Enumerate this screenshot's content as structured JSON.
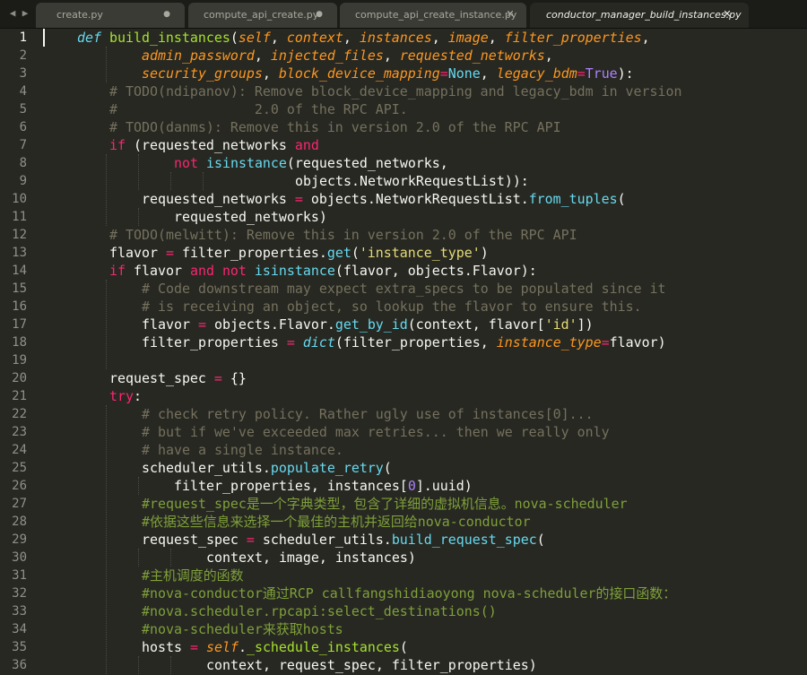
{
  "tabs": [
    {
      "label": "create.py",
      "marker": "●",
      "active": false
    },
    {
      "label": "compute_api_create.py",
      "marker": "●",
      "active": false
    },
    {
      "label": "compute_api_create_instance.py",
      "marker": "✕",
      "active": false
    },
    {
      "label": "conductor_manager_build_instances.py",
      "marker": "✕",
      "active": true
    }
  ],
  "nav": {
    "back": "◀",
    "forward": "▶"
  },
  "editor": {
    "current_line": 1,
    "line_numbers": [
      "1",
      "2",
      "3",
      "4",
      "5",
      "6",
      "7",
      "8",
      "9",
      "10",
      "11",
      "12",
      "13",
      "14",
      "15",
      "16",
      "17",
      "18",
      "19",
      "20",
      "21",
      "22",
      "23",
      "24",
      "25",
      "26",
      "27",
      "28",
      "29",
      "30",
      "31",
      "32",
      "33",
      "34",
      "35",
      "36"
    ],
    "lines": [
      {
        "indent": 4,
        "tokens": [
          [
            "d",
            "def"
          ],
          [
            "t",
            " "
          ],
          [
            "f",
            "build_instances"
          ],
          [
            "t",
            "("
          ],
          [
            "p",
            "self"
          ],
          [
            "t",
            ", "
          ],
          [
            "p",
            "context"
          ],
          [
            "t",
            ", "
          ],
          [
            "p",
            "instances"
          ],
          [
            "t",
            ", "
          ],
          [
            "p",
            "image"
          ],
          [
            "t",
            ", "
          ],
          [
            "p",
            "filter_properties"
          ],
          [
            "t",
            ","
          ]
        ]
      },
      {
        "indent": 12,
        "tokens": [
          [
            "p",
            "admin_password"
          ],
          [
            "t",
            ", "
          ],
          [
            "p",
            "injected_files"
          ],
          [
            "t",
            ", "
          ],
          [
            "p",
            "requested_networks"
          ],
          [
            "t",
            ","
          ]
        ]
      },
      {
        "indent": 12,
        "tokens": [
          [
            "p",
            "security_groups"
          ],
          [
            "t",
            ", "
          ],
          [
            "p",
            "block_device_mapping"
          ],
          [
            "k",
            "="
          ],
          [
            "b",
            "None"
          ],
          [
            "t",
            ", "
          ],
          [
            "p",
            "legacy_bdm"
          ],
          [
            "k",
            "="
          ],
          [
            "n",
            "True"
          ],
          [
            "t",
            "):"
          ]
        ]
      },
      {
        "indent": 8,
        "tokens": [
          [
            "c",
            "# TODO(ndipanov): Remove block_device_mapping and legacy_bdm in version"
          ]
        ]
      },
      {
        "indent": 8,
        "tokens": [
          [
            "c",
            "#                 2.0 of the RPC API."
          ]
        ]
      },
      {
        "indent": 8,
        "tokens": [
          [
            "c",
            "# TODO(danms): Remove this in version 2.0 of the RPC API"
          ]
        ]
      },
      {
        "indent": 8,
        "tokens": [
          [
            "k",
            "if"
          ],
          [
            "t",
            " (requested_networks "
          ],
          [
            "k",
            "and"
          ]
        ]
      },
      {
        "indent": 16,
        "tokens": [
          [
            "k",
            "not"
          ],
          [
            "t",
            " "
          ],
          [
            "b",
            "isinstance"
          ],
          [
            "t",
            "(requested_networks,"
          ]
        ]
      },
      {
        "indent": 31,
        "tokens": [
          [
            "t",
            "objects.NetworkRequestList)):"
          ]
        ]
      },
      {
        "indent": 12,
        "tokens": [
          [
            "t",
            "requested_networks "
          ],
          [
            "k",
            "="
          ],
          [
            "t",
            " objects.NetworkRequestList."
          ],
          [
            "b",
            "from_tuples"
          ],
          [
            "t",
            "("
          ]
        ]
      },
      {
        "indent": 16,
        "tokens": [
          [
            "t",
            "requested_networks)"
          ]
        ]
      },
      {
        "indent": 8,
        "tokens": [
          [
            "c",
            "# TODO(melwitt): Remove this in version 2.0 of the RPC API"
          ]
        ]
      },
      {
        "indent": 8,
        "tokens": [
          [
            "t",
            "flavor "
          ],
          [
            "k",
            "="
          ],
          [
            "t",
            " filter_properties."
          ],
          [
            "b",
            "get"
          ],
          [
            "t",
            "("
          ],
          [
            "s",
            "'instance_type'"
          ],
          [
            "t",
            ")"
          ]
        ]
      },
      {
        "indent": 8,
        "tokens": [
          [
            "k",
            "if"
          ],
          [
            "t",
            " flavor "
          ],
          [
            "k",
            "and"
          ],
          [
            "t",
            " "
          ],
          [
            "k",
            "not"
          ],
          [
            "t",
            " "
          ],
          [
            "b",
            "isinstance"
          ],
          [
            "t",
            "(flavor, objects.Flavor):"
          ]
        ]
      },
      {
        "indent": 12,
        "tokens": [
          [
            "c",
            "# Code downstream may expect extra_specs to be populated since it"
          ]
        ]
      },
      {
        "indent": 12,
        "tokens": [
          [
            "c",
            "# is receiving an object, so lookup the flavor to ensure this."
          ]
        ]
      },
      {
        "indent": 12,
        "tokens": [
          [
            "t",
            "flavor "
          ],
          [
            "k",
            "="
          ],
          [
            "t",
            " objects.Flavor."
          ],
          [
            "b",
            "get_by_id"
          ],
          [
            "t",
            "(context, flavor["
          ],
          [
            "s",
            "'id'"
          ],
          [
            "t",
            "])"
          ]
        ]
      },
      {
        "indent": 12,
        "tokens": [
          [
            "t",
            "filter_properties "
          ],
          [
            "k",
            "="
          ],
          [
            "t",
            " "
          ],
          [
            "d",
            "dict"
          ],
          [
            "t",
            "(filter_properties, "
          ],
          [
            "p",
            "instance_type"
          ],
          [
            "k",
            "="
          ],
          [
            "t",
            "flavor)"
          ]
        ]
      },
      {
        "indent": 0,
        "tokens": []
      },
      {
        "indent": 8,
        "tokens": [
          [
            "t",
            "request_spec "
          ],
          [
            "k",
            "="
          ],
          [
            "t",
            " {}"
          ]
        ]
      },
      {
        "indent": 8,
        "tokens": [
          [
            "k",
            "try"
          ],
          [
            "t",
            ":"
          ]
        ]
      },
      {
        "indent": 12,
        "tokens": [
          [
            "c",
            "# check retry policy. Rather ugly use of instances[0]..."
          ]
        ]
      },
      {
        "indent": 12,
        "tokens": [
          [
            "c",
            "# but if we've exceeded max retries... then we really only"
          ]
        ]
      },
      {
        "indent": 12,
        "tokens": [
          [
            "c",
            "# have a single instance."
          ]
        ]
      },
      {
        "indent": 12,
        "tokens": [
          [
            "t",
            "scheduler_utils."
          ],
          [
            "b",
            "populate_retry"
          ],
          [
            "t",
            "("
          ]
        ]
      },
      {
        "indent": 16,
        "tokens": [
          [
            "t",
            "filter_properties, instances["
          ],
          [
            "n",
            "0"
          ],
          [
            "t",
            "].uuid)"
          ]
        ]
      },
      {
        "indent": 12,
        "tokens": [
          [
            "ch",
            "#request_spec是一个字典类型，包含了详细的虚拟机信息。nova-scheduler"
          ]
        ]
      },
      {
        "indent": 12,
        "tokens": [
          [
            "ch",
            "#依据这些信息来选择一个最佳的主机并返回给nova-conductor"
          ]
        ]
      },
      {
        "indent": 12,
        "tokens": [
          [
            "t",
            "request_spec "
          ],
          [
            "k",
            "="
          ],
          [
            "t",
            " scheduler_utils."
          ],
          [
            "b",
            "build_request_spec"
          ],
          [
            "t",
            "("
          ]
        ]
      },
      {
        "indent": 20,
        "tokens": [
          [
            "t",
            "context, image, instances)"
          ]
        ]
      },
      {
        "indent": 12,
        "tokens": [
          [
            "ch",
            "#主机调度的函数"
          ]
        ]
      },
      {
        "indent": 12,
        "tokens": [
          [
            "ch",
            "#nova-conductor通过RCP callfangshidiaoyong nova-scheduler的接口函数："
          ]
        ]
      },
      {
        "indent": 12,
        "tokens": [
          [
            "ch",
            "#nova.scheduler.rpcapi:select_destinations()"
          ]
        ]
      },
      {
        "indent": 12,
        "tokens": [
          [
            "ch",
            "#nova-scheduler来获取hosts"
          ]
        ]
      },
      {
        "indent": 12,
        "tokens": [
          [
            "t",
            "hosts "
          ],
          [
            "k",
            "="
          ],
          [
            "t",
            " "
          ],
          [
            "p",
            "self"
          ],
          [
            "t",
            "."
          ],
          [
            "f",
            "_schedule_instances"
          ],
          [
            "t",
            "("
          ]
        ]
      },
      {
        "indent": 20,
        "tokens": [
          [
            "t",
            "context, request_spec, filter_properties)"
          ]
        ]
      }
    ]
  }
}
